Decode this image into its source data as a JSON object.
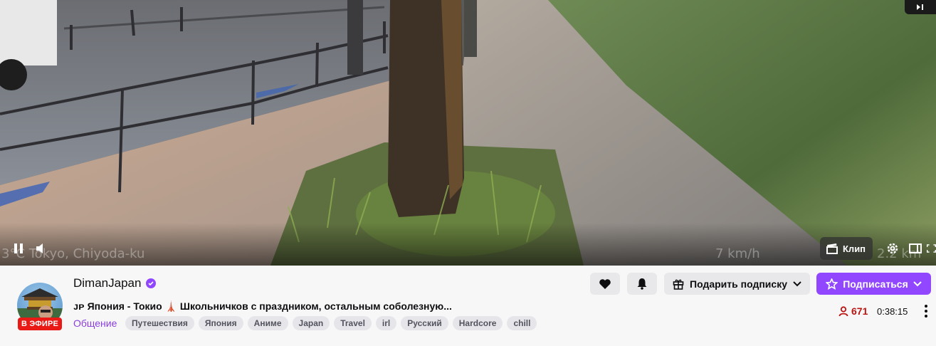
{
  "video": {
    "overlay_location": "3°C Tokyo, Chiyoda-ku",
    "overlay_speed": "7 km/h",
    "overlay_extra": "2.2 km",
    "controls": {
      "pause_icon": "pause-icon",
      "volume_icon": "volume-icon",
      "clip_label": "Клип",
      "settings_icon": "gear-icon",
      "theatre_icon": "theatre-mode-icon",
      "fullscreen_icon": "fullscreen-icon"
    }
  },
  "channel": {
    "name": "DimanJapan",
    "verified": true,
    "live_badge": "В ЭФИРЕ",
    "title": "ᴊᴘ Япония - Токио 🗼 Школьничков с праздником, остальным соболезную...",
    "category": "Общение",
    "tags": [
      "Путешествия",
      "Япония",
      "Аниме",
      "Japan",
      "Travel",
      "irl",
      "Русский",
      "Hardcore",
      "chill"
    ],
    "viewers": "671",
    "uptime": "0:38:15"
  },
  "actions": {
    "follow_icon": "heart-icon",
    "notifications_icon": "bell-icon",
    "gift_label": "Подарить подписку",
    "subscribe_label": "Подписаться"
  },
  "colors": {
    "accent": "#9147ff",
    "live": "#e91916",
    "viewers": "#bb1411"
  }
}
